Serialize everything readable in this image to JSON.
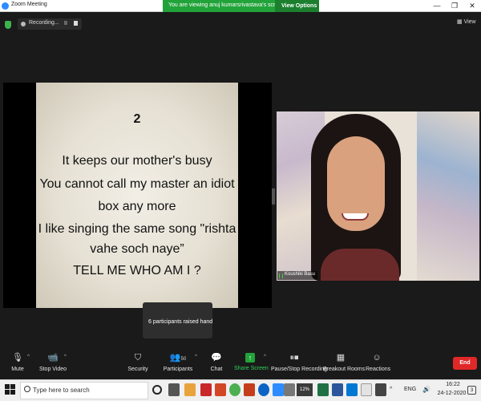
{
  "window": {
    "title": "Zoom Meeting",
    "minimize": "—",
    "restore": "❐",
    "close": "✕"
  },
  "banner": {
    "text": "You are viewing anuj kumarsrivastava's screen",
    "view_options": "View Options ⌄"
  },
  "recording": {
    "label": "Recording...",
    "pause": "II"
  },
  "view_button": "View",
  "slide": {
    "number": "2",
    "lines": [
      "It keeps our mother's busy",
      "You cannot call my master an idiot",
      "box any more",
      "I like singing the same song \"rishta",
      "vahe soch naye”",
      "TELL ME WHO AM I ?"
    ]
  },
  "participant": {
    "name": "Koushiki Basu"
  },
  "tooltip": "6 participants raised hand",
  "toolbar": {
    "mute": "Mute",
    "stop_video": "Stop Video",
    "security": "Security",
    "participants": "Participants",
    "participants_count": "50",
    "chat": "Chat",
    "share_screen": "Share Screen",
    "pause_stop_recording": "Pause/Stop Recording",
    "breakout_rooms": "Breakout Rooms",
    "reactions": "Reactions",
    "end": "End"
  },
  "taskbar": {
    "search_placeholder": "Type here to search",
    "battery_text": "12%",
    "language": "ENG",
    "time": "16:22",
    "date": "24-12-2020",
    "notifications": "3"
  },
  "colors": {
    "banner_green": "#22a33a",
    "end_red": "#e02828",
    "zoom_blue": "#2d8cff"
  }
}
